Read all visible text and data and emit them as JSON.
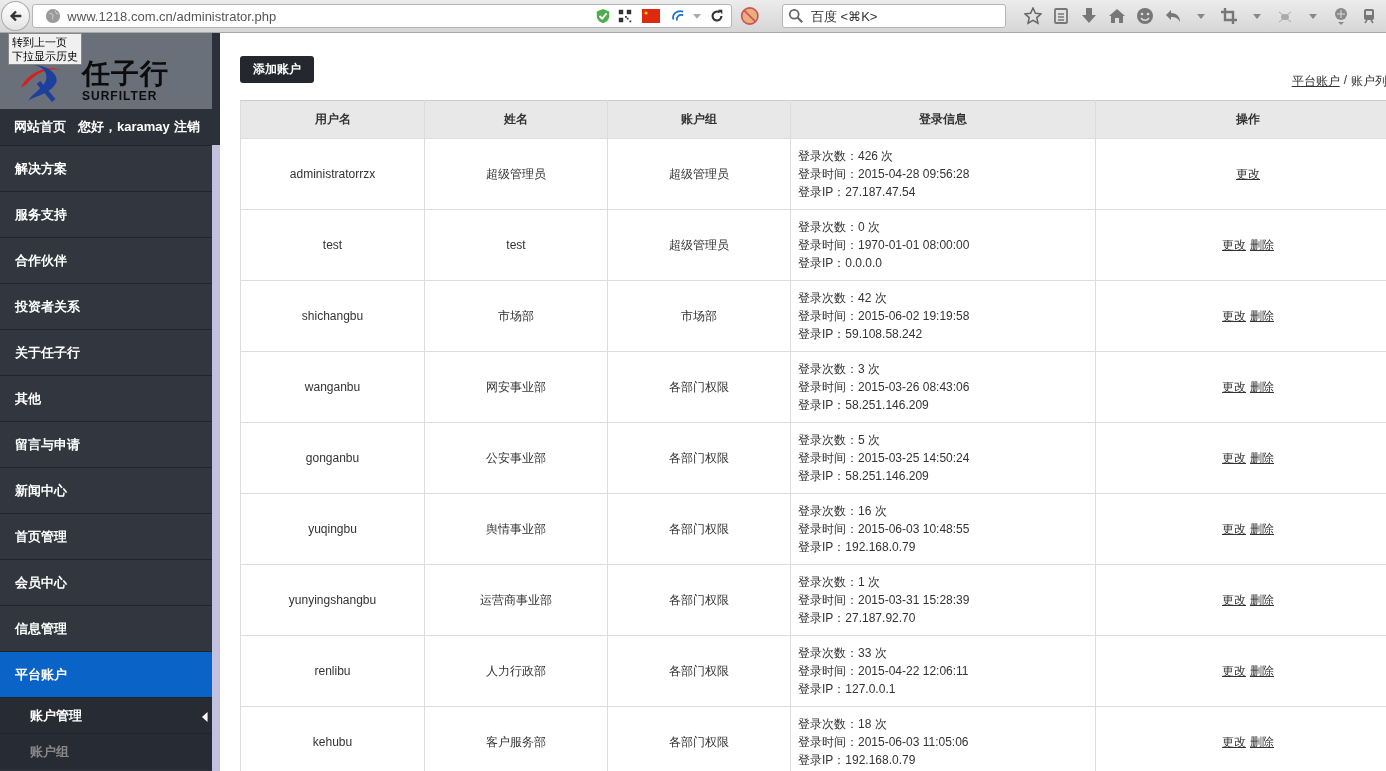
{
  "browser": {
    "url": "www.1218.com.cn/administrator.php",
    "search": {
      "placeholder": "百度 <⌘K>"
    },
    "tooltip": [
      "转到上一页",
      "下拉显示历史"
    ]
  },
  "sidebar": {
    "logo_text": "任子行",
    "logo_subtext": "SURFILTER",
    "home_link": "网站首页",
    "greeting": "您好，karamay",
    "logout": "注销",
    "items": [
      {
        "label": "解决方案",
        "selected": false
      },
      {
        "label": "服务支持",
        "selected": false
      },
      {
        "label": "合作伙伴",
        "selected": false
      },
      {
        "label": "投资者关系",
        "selected": false
      },
      {
        "label": "关于任子行",
        "selected": false
      },
      {
        "label": "其他",
        "selected": false
      },
      {
        "label": "留言与申请",
        "selected": false
      },
      {
        "label": "新闻中心",
        "selected": false
      },
      {
        "label": "首页管理",
        "selected": false
      },
      {
        "label": "会员中心",
        "selected": false
      },
      {
        "label": "信息管理",
        "selected": false
      },
      {
        "label": "平台账户",
        "selected": true,
        "children": [
          {
            "label": "账户管理",
            "selected": true
          },
          {
            "label": "账户组",
            "selected": false
          }
        ]
      }
    ]
  },
  "content": {
    "add_button": "添加账户",
    "breadcrumb": {
      "link": "平台账户",
      "separator": "/",
      "current": "账户列"
    },
    "table": {
      "columns": [
        "用户名",
        "姓名",
        "账户组",
        "登录信息",
        "操作"
      ],
      "rows": [
        {
          "username": "administratorrzx",
          "name": "超级管理员",
          "group": "超级管理员",
          "login_info": [
            "登录次数：426 次",
            "登录时间：2015-04-28 09:56:28",
            "登录IP：27.187.47.54"
          ],
          "actions": [
            "更改"
          ]
        },
        {
          "username": "test",
          "name": "test",
          "group": "超级管理员",
          "login_info": [
            "登录次数：0 次",
            "登录时间：1970-01-01 08:00:00",
            "登录IP：0.0.0.0"
          ],
          "actions": [
            "更改",
            "删除"
          ]
        },
        {
          "username": "shichangbu",
          "name": "市场部",
          "group": "市场部",
          "login_info": [
            "登录次数：42 次",
            "登录时间：2015-06-02 19:19:58",
            "登录IP：59.108.58.242"
          ],
          "actions": [
            "更改",
            "删除"
          ]
        },
        {
          "username": "wanganbu",
          "name": "网安事业部",
          "group": "各部门权限",
          "login_info": [
            "登录次数：3 次",
            "登录时间：2015-03-26 08:43:06",
            "登录IP：58.251.146.209"
          ],
          "actions": [
            "更改",
            "删除"
          ]
        },
        {
          "username": "gonganbu",
          "name": "公安事业部",
          "group": "各部门权限",
          "login_info": [
            "登录次数：5 次",
            "登录时间：2015-03-25 14:50:24",
            "登录IP：58.251.146.209"
          ],
          "actions": [
            "更改",
            "删除"
          ]
        },
        {
          "username": "yuqingbu",
          "name": "舆情事业部",
          "group": "各部门权限",
          "login_info": [
            "登录次数：16 次",
            "登录时间：2015-06-03 10:48:55",
            "登录IP：192.168.0.79"
          ],
          "actions": [
            "更改",
            "删除"
          ]
        },
        {
          "username": "yunyingshangbu",
          "name": "运营商事业部",
          "group": "各部门权限",
          "login_info": [
            "登录次数：1 次",
            "登录时间：2015-03-31 15:28:39",
            "登录IP：27.187.92.70"
          ],
          "actions": [
            "更改",
            "删除"
          ]
        },
        {
          "username": "renlibu",
          "name": "人力行政部",
          "group": "各部门权限",
          "login_info": [
            "登录次数：33 次",
            "登录时间：2015-04-22 12:06:11",
            "登录IP：127.0.0.1"
          ],
          "actions": [
            "更改",
            "删除"
          ]
        },
        {
          "username": "kehubu",
          "name": "客户服务部",
          "group": "各部门权限",
          "login_info": [
            "登录次数：18 次",
            "登录时间：2015-06-03 11:05:06",
            "登录IP：192.168.0.79"
          ],
          "actions": [
            "更改",
            "删除"
          ]
        }
      ]
    }
  }
}
